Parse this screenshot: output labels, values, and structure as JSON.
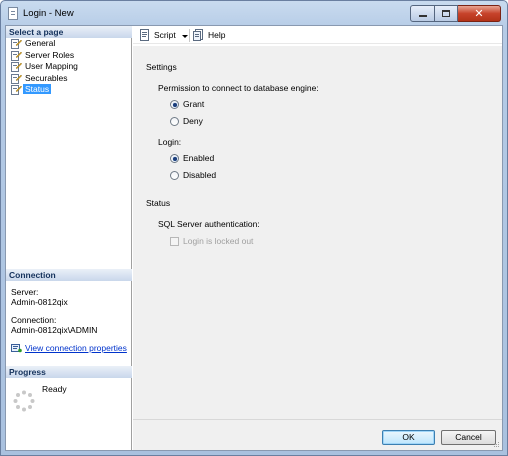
{
  "window": {
    "title": "Login - New"
  },
  "left_pane": {
    "select_page_header": "Select a page",
    "pages": [
      {
        "label": "General",
        "icon": "page-wrench-icon"
      },
      {
        "label": "Server Roles",
        "icon": "page-wrench-icon"
      },
      {
        "label": "User Mapping",
        "icon": "page-wrench-icon"
      },
      {
        "label": "Securables",
        "icon": "page-wrench-icon"
      },
      {
        "label": "Status",
        "icon": "page-wrench-icon",
        "selected": true
      }
    ],
    "connection": {
      "header": "Connection",
      "server_label": "Server:",
      "server_value": "Admin-0812qix",
      "connection_label": "Connection:",
      "connection_value": "Admin-0812qix\\ADMIN",
      "view_properties_link": "View connection properties"
    },
    "progress": {
      "header": "Progress",
      "status": "Ready"
    }
  },
  "toolbar": {
    "script_label": "Script",
    "help_label": "Help"
  },
  "content": {
    "settings_title": "Settings",
    "permission_label": "Permission to connect to database engine:",
    "grant_label": "Grant",
    "deny_label": "Deny",
    "permission_selected": "Grant",
    "login_label": "Login:",
    "enabled_label": "Enabled",
    "disabled_label": "Disabled",
    "login_selected": "Enabled",
    "status_title": "Status",
    "sql_auth_label": "SQL Server authentication:",
    "locked_out_label": "Login is locked out",
    "locked_out_checked": false
  },
  "buttons": {
    "ok_label": "OK",
    "cancel_label": "Cancel"
  },
  "colors": {
    "selection": "#3399ff",
    "link": "#0033cc",
    "close_button": "#c7432b"
  }
}
